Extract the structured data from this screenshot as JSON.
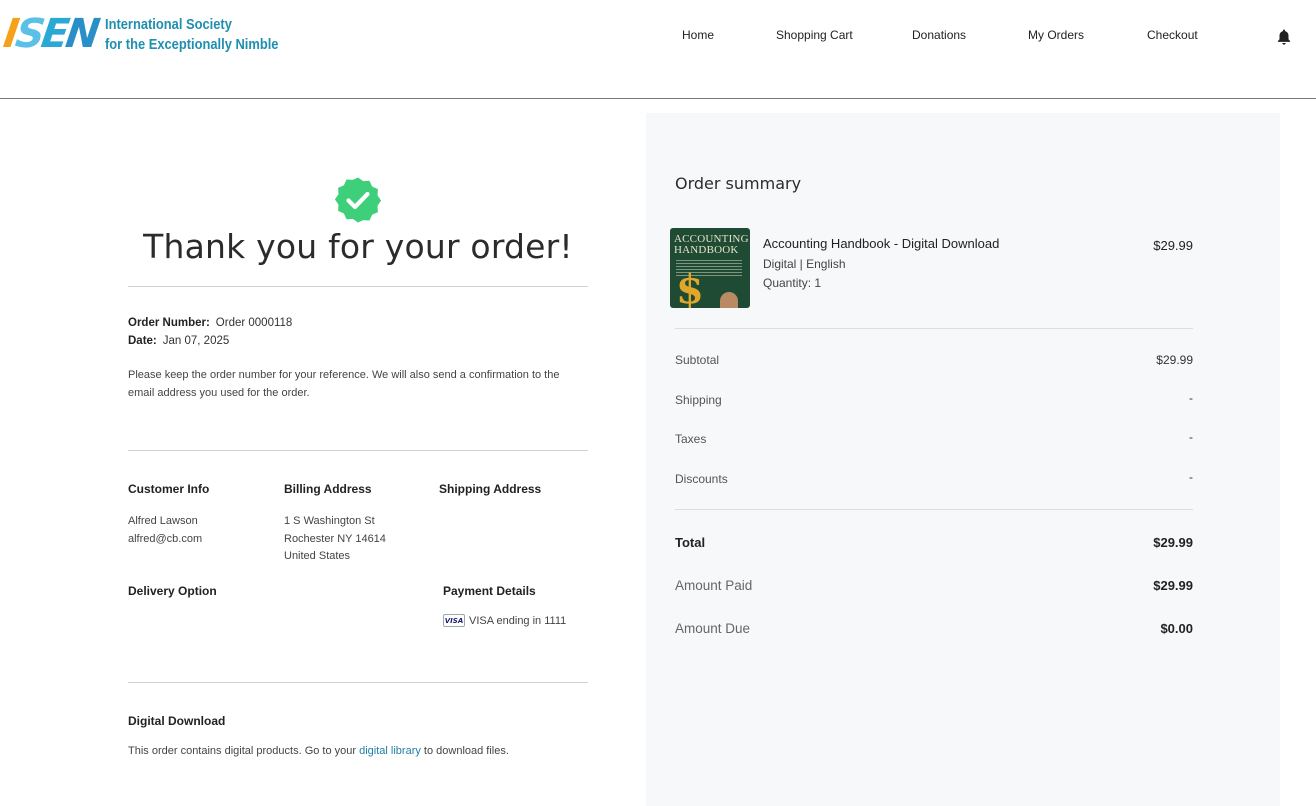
{
  "brand": {
    "letters": [
      "I",
      "S",
      "E",
      "N"
    ],
    "name_line1": "International Society",
    "name_line2": "for the Exceptionally Nimble"
  },
  "nav": {
    "items": [
      "Home",
      "Shopping Cart",
      "Donations",
      "My Orders",
      "Checkout"
    ],
    "notifications_icon": "bell-icon"
  },
  "confirmation": {
    "icon": "check-badge-icon",
    "heading": "Thank you for your order!",
    "order_number_label": "Order Number:",
    "order_number": "Order 0000118",
    "date_label": "Date:",
    "date": "Jan 07, 2025",
    "note": "Please keep the order number for your reference. We will also send a confirmation to the email address you used for the order."
  },
  "customer": {
    "title": "Customer Info",
    "name": "Alfred Lawson",
    "email": "alfred@cb.com"
  },
  "billing": {
    "title": "Billing Address",
    "line1": "1 S Washington St",
    "line2": "Rochester NY 14614",
    "line3": "United States"
  },
  "shipping_address": {
    "title": "Shipping Address"
  },
  "delivery": {
    "title": "Delivery Option"
  },
  "payment": {
    "title": "Payment Details",
    "card_brand": "VISA",
    "card_text": "VISA ending in 1111"
  },
  "digital": {
    "title": "Digital Download",
    "text_before": "This order contains digital products. Go to your ",
    "link": "digital library",
    "text_after": " to download files."
  },
  "summary": {
    "title": "Order summary",
    "item": {
      "cover_title_line1": "ACCOUNTING",
      "cover_title_line2": "HANDBOOK",
      "name": "Accounting Handbook - Digital Download",
      "meta": "Digital | English",
      "quantity": "Quantity: 1",
      "price": "$29.99"
    },
    "subtotal_label": "Subtotal",
    "subtotal": "$29.99",
    "shipping_label": "Shipping",
    "shipping": "-",
    "taxes_label": "Taxes",
    "taxes": "-",
    "discounts_label": "Discounts",
    "discounts": "-",
    "total_label": "Total",
    "total": "$29.99",
    "paid_label": "Amount Paid",
    "paid": "$29.99",
    "due_label": "Amount Due",
    "due": "$0.00"
  },
  "colors": {
    "success": "#3ecf7a",
    "link": "#1f7fa8",
    "panel_bg": "#f7f8fa"
  }
}
